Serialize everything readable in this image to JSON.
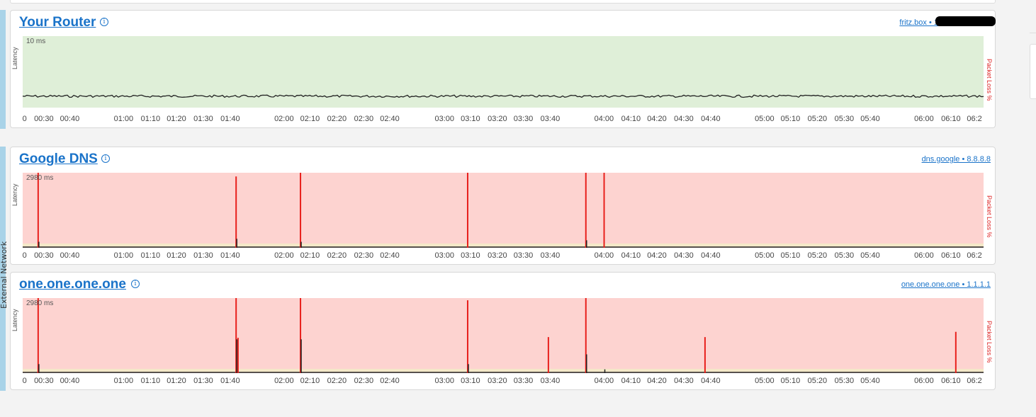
{
  "sections": {
    "external_label": "External Network"
  },
  "panels": [
    {
      "id": "router",
      "title": "Your Router",
      "host": "fritz.box • 1",
      "scale_label": "10 ms",
      "latency_label": "Latency",
      "loss_label": "Packet Loss %",
      "background": "#dfefd8",
      "x_ticks": [
        "0",
        "00:30",
        "00:40",
        "01:00",
        "01:10",
        "01:20",
        "01:30",
        "01:40",
        "02:00",
        "02:10",
        "02:20",
        "02:30",
        "02:40",
        "03:00",
        "03:10",
        "03:20",
        "03:30",
        "03:40",
        "04:00",
        "04:10",
        "04:20",
        "04:30",
        "04:40",
        "05:00",
        "05:10",
        "05:20",
        "05:30",
        "05:40",
        "06:00",
        "06:10",
        "06:2"
      ]
    },
    {
      "id": "google",
      "title": "Google DNS",
      "host": "dns.google • 8.8.8.8",
      "scale_label": "2980 ms",
      "latency_label": "Latency",
      "loss_label": "Packet Loss %",
      "background": "#fdd3d0",
      "x_ticks": [
        "0",
        "00:30",
        "00:40",
        "01:00",
        "01:10",
        "01:20",
        "01:30",
        "01:40",
        "02:00",
        "02:10",
        "02:20",
        "02:30",
        "02:40",
        "03:00",
        "03:10",
        "03:20",
        "03:30",
        "03:40",
        "04:00",
        "04:10",
        "04:20",
        "04:30",
        "04:40",
        "05:00",
        "05:10",
        "05:20",
        "05:30",
        "05:40",
        "06:00",
        "06:10",
        "06:2"
      ]
    },
    {
      "id": "cloudflare",
      "title": "one.one.one.one",
      "host": "one.one.one.one • 1.1.1.1",
      "scale_label": "2980 ms",
      "latency_label": "Latency",
      "loss_label": "Packet Loss %",
      "background": "#fdd3d0",
      "x_ticks": [
        "0",
        "00:30",
        "00:40",
        "01:00",
        "01:10",
        "01:20",
        "01:30",
        "01:40",
        "02:00",
        "02:10",
        "02:20",
        "02:30",
        "02:40",
        "03:00",
        "03:10",
        "03:20",
        "03:30",
        "03:40",
        "04:00",
        "04:10",
        "04:20",
        "04:30",
        "04:40",
        "05:00",
        "05:10",
        "05:20",
        "05:30",
        "05:40",
        "06:00",
        "06:10",
        "06:2"
      ]
    }
  ],
  "chart_data": [
    {
      "type": "line",
      "panel": "router",
      "series": [
        {
          "values_note": "",
          "loss_spikes": []
        }
      ],
      "ylim_ms": [
        0,
        10
      ],
      "baseline_ms": 1.2
    },
    {
      "type": "bar",
      "panel": "google",
      "loss_spikes_pct": [
        {
          "t": 0.008,
          "v": 100
        },
        {
          "t": 0.214,
          "v": 95
        },
        {
          "t": 0.281,
          "v": 100
        },
        {
          "t": 0.455,
          "v": 100
        },
        {
          "t": 0.578,
          "v": 100
        },
        {
          "t": 0.597,
          "v": 100
        }
      ],
      "latency_spikes_pct": [
        {
          "t": 0.008,
          "v": 8
        },
        {
          "t": 0.214,
          "v": 12
        },
        {
          "t": 0.281,
          "v": 8
        },
        {
          "t": 0.578,
          "v": 10
        }
      ]
    },
    {
      "type": "bar",
      "panel": "cloudflare",
      "loss_spikes_pct": [
        {
          "t": 0.008,
          "v": 100
        },
        {
          "t": 0.214,
          "v": 100
        },
        {
          "t": 0.216,
          "v": 47
        },
        {
          "t": 0.281,
          "v": 100
        },
        {
          "t": 0.455,
          "v": 97
        },
        {
          "t": 0.539,
          "v": 48
        },
        {
          "t": 0.578,
          "v": 100
        },
        {
          "t": 0.702,
          "v": 48
        },
        {
          "t": 0.963,
          "v": 55
        }
      ],
      "latency_spikes_pct": [
        {
          "t": 0.008,
          "v": 12
        },
        {
          "t": 0.214,
          "v": 45
        },
        {
          "t": 0.281,
          "v": 45
        },
        {
          "t": 0.455,
          "v": 12
        },
        {
          "t": 0.578,
          "v": 25
        },
        {
          "t": 0.597,
          "v": 5
        }
      ]
    }
  ]
}
